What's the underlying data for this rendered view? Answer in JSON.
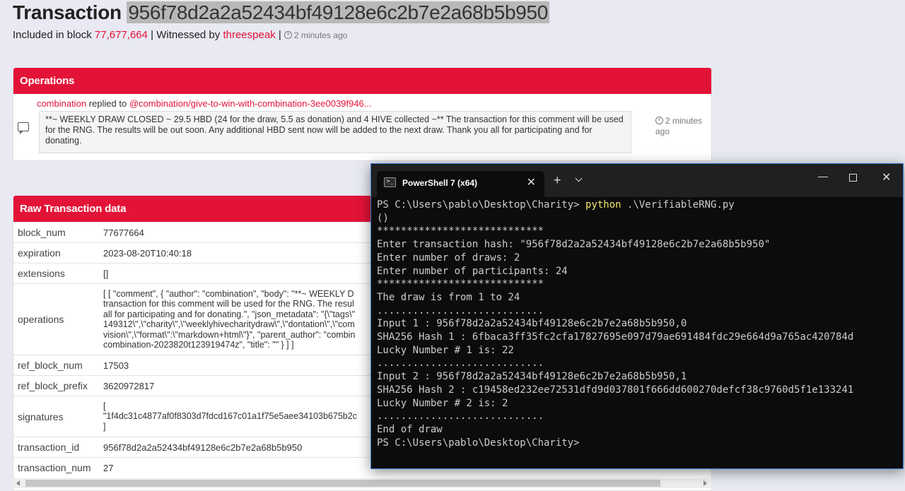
{
  "header": {
    "title_label": "Transaction",
    "tx_hash": "956f78d2a2a52434bf49128e6c2b7e2a68b5b950",
    "included_prefix": "Included in block",
    "block_number": "77,677,664",
    "witnessed_prefix": "| Witnessed by",
    "witness": "threespeak",
    "sep": "|",
    "time_ago": "2 minutes ago"
  },
  "operations": {
    "heading": "Operations",
    "author": "combination",
    "replied_to_text": "replied to",
    "parent_link": "@combination/give-to-win-with-combination-3ee0039f946...",
    "body": "**~ WEEKLY DRAW CLOSED ~ 29.5 HBD (24 for the draw, 5.5 as donation) and 4 HIVE collected ~** The transaction for this comment will be used for the RNG. The results will be out soon. Any additional HBD sent now will be added to the next draw. Thank you all for participating and for donating.",
    "time_ago": "2 minutes ago"
  },
  "raw": {
    "heading": "Raw Transaction data",
    "rows": [
      {
        "key": "block_num",
        "value": "77677664"
      },
      {
        "key": "expiration",
        "value": "2023-08-20T10:40:18"
      },
      {
        "key": "extensions",
        "value": "[]"
      },
      {
        "key": "operations",
        "value": "[ [ \"comment\", { \"author\": \"combination\", \"body\": \"**~ WEEKLY D\ntransaction for this comment will be used for the RNG. The resul\nall for participating and for donating.\", \"json_metadata\": \"{\\\"tags\\\"\n149312\\\",\\\"charity\\\",\\\"weeklyhivecharitydraw\\\",\\\"dontation\\\",\\\"com\nvision\\\",\\\"format\\\":\\\"markdown+html\\\"}\", \"parent_author\": \"combin\ncombination-2023820t123919474z\", \"title\": \"\" } ] ]"
      },
      {
        "key": "ref_block_num",
        "value": "17503"
      },
      {
        "key": "ref_block_prefix",
        "value": "3620972817"
      },
      {
        "key": "signatures",
        "value": "[\n\"1f4dc31c4877af0f8303d7fdcd167c01a1f75e5aee34103b675b2c\n]"
      },
      {
        "key": "transaction_id",
        "value": "956f78d2a2a52434bf49128e6c2b7e2a68b5b950"
      },
      {
        "key": "transaction_num",
        "value": "27"
      }
    ]
  },
  "terminal": {
    "tab_title": "PowerShell 7 (x64)",
    "lines": [
      {
        "prompt": "PS C:\\Users\\pablo\\Desktop\\Charity> ",
        "cmd": "python",
        "rest": " .\\VerifiableRNG.py"
      },
      {
        "text": "()"
      },
      {
        "text": "****************************"
      },
      {
        "text": "Enter transaction hash: \"956f78d2a2a52434bf49128e6c2b7e2a68b5b950\""
      },
      {
        "text": "Enter number of draws: 2"
      },
      {
        "text": "Enter number of participants: 24"
      },
      {
        "text": "****************************"
      },
      {
        "text": "The draw is from 1 to 24"
      },
      {
        "text": "............................"
      },
      {
        "text": "Input 1 : 956f78d2a2a52434bf49128e6c2b7e2a68b5b950,0"
      },
      {
        "text": "SHA256 Hash 1 : 6fbaca3ff35fc2cfa17827695e097d79ae691484fdc29e664d9a765ac420784d"
      },
      {
        "text": "Lucky Number # 1 is: 22"
      },
      {
        "text": "............................"
      },
      {
        "text": "Input 2 : 956f78d2a2a52434bf49128e6c2b7e2a68b5b950,1"
      },
      {
        "text": "SHA256 Hash 2 : c19458ed232ee72531dfd9d037801f666dd600270defcf38c9760d5f1e133241"
      },
      {
        "text": "Lucky Number # 2 is: 2"
      },
      {
        "text": "............................"
      },
      {
        "text": "End of draw"
      },
      {
        "text": "PS C:\\Users\\pablo\\Desktop\\Charity>"
      }
    ]
  },
  "colors": {
    "accent": "#e31337",
    "terminal_bg": "#0c0c0c",
    "command": "#f3e56a"
  },
  "icons": [
    "clock-icon",
    "comment-icon",
    "powershell-icon",
    "close-icon",
    "plus-icon",
    "chevron-down-icon",
    "minimize-icon",
    "maximize-icon"
  ]
}
